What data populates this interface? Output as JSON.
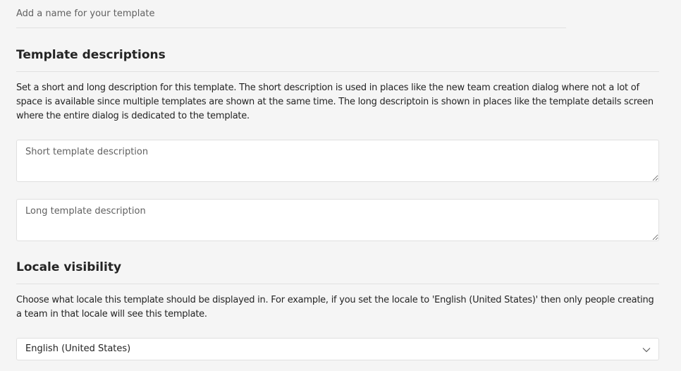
{
  "template_name": {
    "placeholder": "Add a name for your template",
    "value": ""
  },
  "descriptions": {
    "title": "Template descriptions",
    "help_text": "Set a short and long description for this template. The short description is used in places like the new team creation dialog where not a lot of space is available since multiple templates are shown at the same time. The long descriptoin is shown in places like the template details screen where the entire dialog is dedicated to the template.",
    "short_placeholder": "Short template description",
    "long_placeholder": "Long template description"
  },
  "locale": {
    "title": "Locale visibility",
    "help_text": "Choose what locale this template should be displayed in. For example, if you set the locale to 'English (United States)' then only people creating a team in that locale will see this template.",
    "selected": "English (United States)",
    "chevron_icon": "chevron-down-icon"
  }
}
